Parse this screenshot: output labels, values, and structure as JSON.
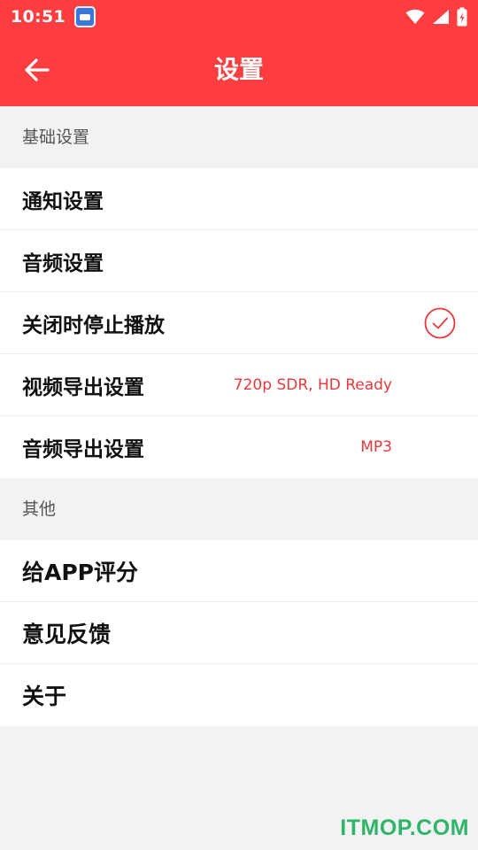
{
  "status_bar": {
    "time": "10:51",
    "app_icon": "bus-app-icon",
    "icons": [
      "wifi-icon",
      "cell-signal-icon",
      "battery-charging-icon"
    ]
  },
  "header": {
    "back_icon": "arrow-left-icon",
    "title": "设置",
    "color": "#fd3d3f"
  },
  "sections": {
    "basic": {
      "title": "基础设置",
      "items": [
        {
          "label": "通知设置"
        },
        {
          "label": "音频设置"
        },
        {
          "label": "关闭时停止播放",
          "checked": true
        },
        {
          "label": "视频导出设置",
          "value": "720p SDR, HD Ready"
        },
        {
          "label": "音频导出设置",
          "value": "MP3"
        }
      ]
    },
    "other": {
      "title": "其他",
      "items": [
        {
          "label": "给APP评分"
        },
        {
          "label": "意见反馈"
        },
        {
          "label": "关于"
        }
      ]
    }
  },
  "accent_color": "#e8393c",
  "watermark": "ITMOP.COM"
}
